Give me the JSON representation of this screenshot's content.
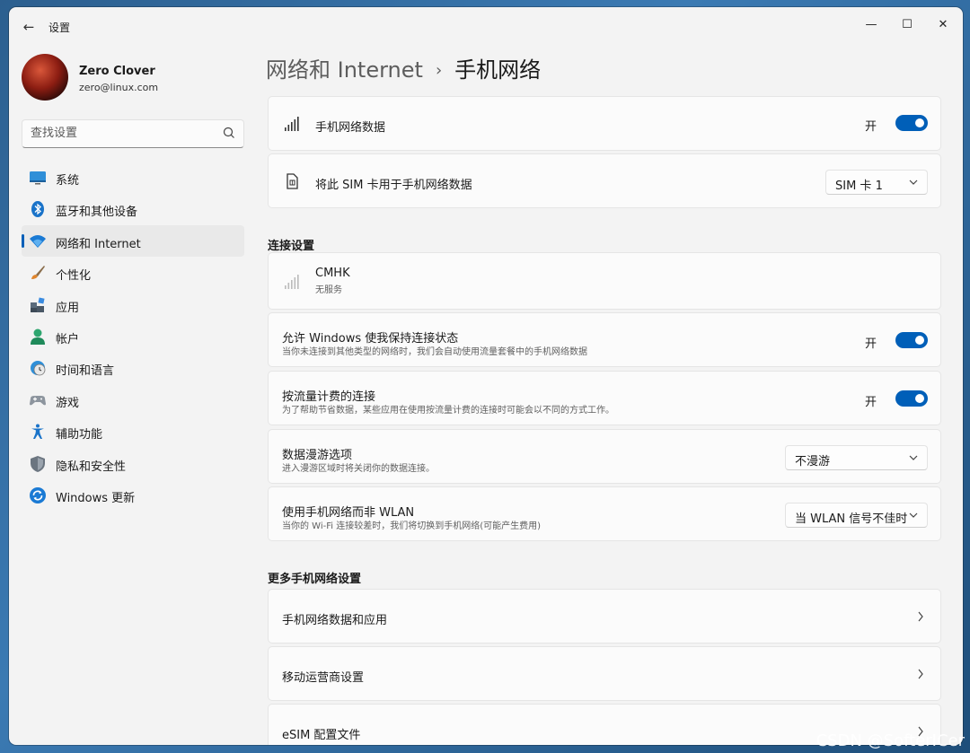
{
  "titlebar": {
    "back": "←",
    "title": "设置",
    "minimize": "—",
    "maximize": "☐",
    "close": "✕"
  },
  "profile": {
    "name": "Zero Clover",
    "email": "zero@linux.com"
  },
  "search": {
    "placeholder": "查找设置"
  },
  "sidebar": {
    "items": [
      {
        "label": "系统",
        "icon": "monitor-icon"
      },
      {
        "label": "蓝牙和其他设备",
        "icon": "bluetooth-icon"
      },
      {
        "label": "网络和 Internet",
        "icon": "wifi-icon",
        "active": true
      },
      {
        "label": "个性化",
        "icon": "brush-icon"
      },
      {
        "label": "应用",
        "icon": "apps-icon"
      },
      {
        "label": "帐户",
        "icon": "person-icon"
      },
      {
        "label": "时间和语言",
        "icon": "globe-clock-icon"
      },
      {
        "label": "游戏",
        "icon": "gamepad-icon"
      },
      {
        "label": "辅助功能",
        "icon": "accessibility-icon"
      },
      {
        "label": "隐私和安全性",
        "icon": "shield-icon"
      },
      {
        "label": "Windows 更新",
        "icon": "update-icon"
      }
    ]
  },
  "breadcrumb": {
    "parent": "网络和 Internet",
    "separator": "›",
    "current": "手机网络"
  },
  "cellular": {
    "title": "手机网络数据",
    "toggle_text": "开",
    "toggle_on": true
  },
  "sim": {
    "title": "将此 SIM 卡用于手机网络数据",
    "value": "SIM 卡 1"
  },
  "connection_settings": {
    "header": "连接设置",
    "carrier": {
      "name": "CMHK",
      "status": "无服务"
    },
    "keep_connected": {
      "title": "允许 Windows 使我保持连接状态",
      "subtitle": "当你未连接到其他类型的网络时，我们会自动使用流量套餐中的手机网络数据",
      "toggle_text": "开",
      "toggle_on": true
    },
    "metered": {
      "title": "按流量计费的连接",
      "subtitle": "为了帮助节省数据，某些应用在使用按流量计费的连接时可能会以不同的方式工作。",
      "toggle_text": "开",
      "toggle_on": true
    },
    "roaming": {
      "title": "数据漫游选项",
      "subtitle": "进入漫游区域时将关闭你的数据连接。",
      "value": "不漫游"
    },
    "prefer_cellular": {
      "title": "使用手机网络而非 WLAN",
      "subtitle": "当你的 Wi-Fi 连接较差时，我们将切换到手机网络(可能产生费用)",
      "value": "当 WLAN 信号不佳时"
    }
  },
  "more_settings": {
    "header": "更多手机网络设置",
    "items": [
      "手机网络数据和应用",
      "移动运营商设置",
      "eSIM 配置文件"
    ]
  },
  "watermark": "CSDN @SofterICer",
  "colors": {
    "accent": "#005fb8",
    "window_bg": "#f3f3f3",
    "card_bg": "#fbfbfb"
  }
}
